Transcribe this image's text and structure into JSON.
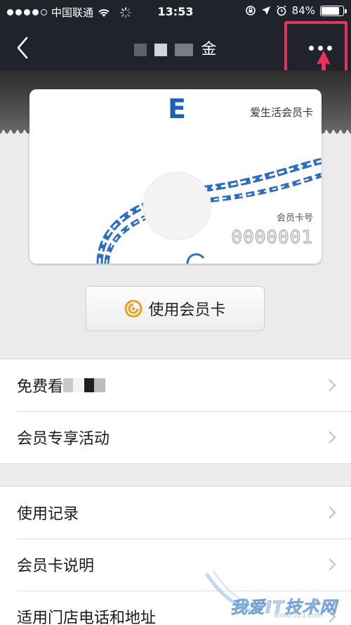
{
  "status_bar": {
    "carrier": "中国联通",
    "time": "13:53",
    "battery_percent": "84%",
    "battery_level": 0.84,
    "signal_dots_filled": 4,
    "signal_dots_total": 5
  },
  "nav": {
    "title_visible": "金",
    "back_icon": "chevron-left-icon",
    "more_icon": "more-dots-icon"
  },
  "card": {
    "logo_text": "E",
    "name": "爱生活会员卡",
    "number_label": "会员卡号",
    "number": "0000001",
    "brand_color": "#1b62b5"
  },
  "use_button": {
    "label": "使用会员卡",
    "icon": "card-scan-icon",
    "icon_color": "#f0a020"
  },
  "list_group_1": [
    {
      "label": "免费看"
    },
    {
      "label": "会员专享活动"
    }
  ],
  "list_group_2": [
    {
      "label": "使用记录"
    },
    {
      "label": "会员卡说明"
    },
    {
      "label": "适用门店电话和地址"
    }
  ],
  "annotation": {
    "highlight_color": "#e8315b"
  },
  "watermark": {
    "text": "我爱IT技术网",
    "url": "www.52ij.com"
  }
}
